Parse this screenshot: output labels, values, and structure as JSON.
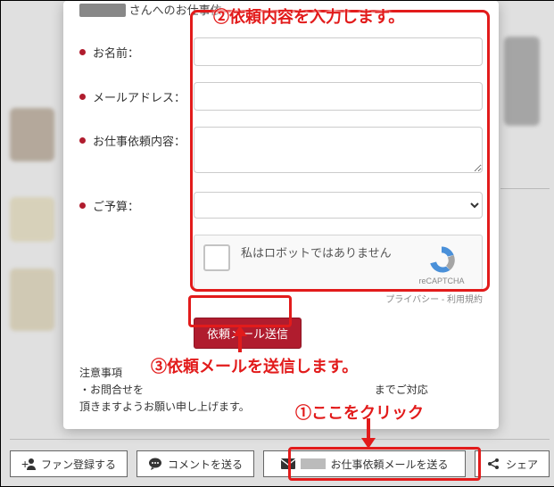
{
  "modal": {
    "title_suffix": "さんへのお仕事依…",
    "labels": {
      "name": "お名前：",
      "email": "メールアドレス：",
      "request": "お仕事依頼内容：",
      "budget": "ご予算："
    },
    "recaptcha": {
      "text": "私はロボットではありません",
      "brand": "reCAPTCHA",
      "privacy": "プライバシー",
      "terms": "利用規約",
      "sep": " - "
    },
    "submit": "依頼メール送信",
    "notice_heading": "注意事項",
    "notice_body_prefix": "・お問合せを",
    "notice_body_middle": "までご対応",
    "notice_body_line2": "頂きますようお願い申し上げます。"
  },
  "annotations": {
    "step1": "①ここをクリック",
    "step2": "②依頼内容を入力します。",
    "step3": "③依頼メールを送信します。"
  },
  "actionbar": {
    "fan": "ファン登録する",
    "comment": "コメントを送る",
    "mail": "お仕事依頼メールを送る",
    "share": "シェア"
  },
  "colors": {
    "accent": "#b01c2e",
    "annotation": "#e21b1b"
  }
}
